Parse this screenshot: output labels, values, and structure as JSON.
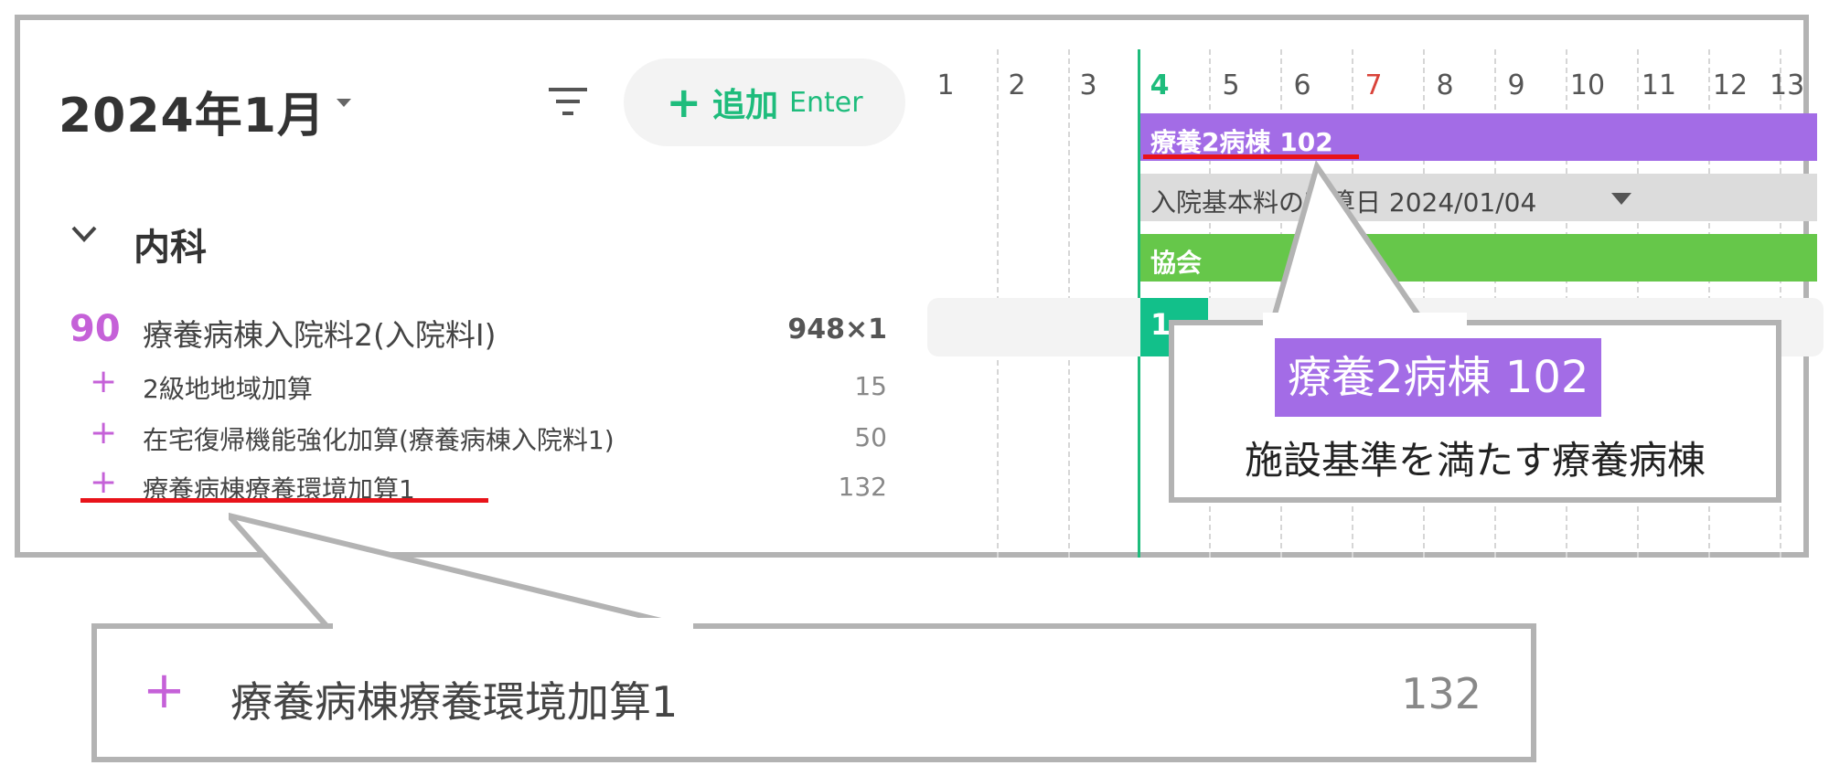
{
  "header": {
    "month": "2024年1月",
    "add_label": "追加",
    "add_hint": "Enter"
  },
  "department": {
    "label": "内科"
  },
  "main_item": {
    "code": "90",
    "name": "療養病棟入院料2(入院料I)",
    "qty": "948×1"
  },
  "add_items": [
    {
      "name": "2級地地域加算",
      "points": "15"
    },
    {
      "name": "在宅復帰機能強化加算(療養病棟入院料1)",
      "points": "50"
    },
    {
      "name": "療養病棟療養環境加算1",
      "points": "132"
    }
  ],
  "calendar": {
    "days": [
      "1",
      "2",
      "3",
      "4",
      "5",
      "6",
      "7",
      "8",
      "9",
      "10",
      "11",
      "12",
      "13"
    ],
    "today": "4",
    "holiday": "7",
    "today_color": "#1ebc7c",
    "holiday_color": "#d9433a"
  },
  "bars": {
    "ward": "療養2病棟 102",
    "basic": "入院基本料の起算日 2024/01/04",
    "association": "協会",
    "green_short": "1"
  },
  "callout_ward": {
    "tag": "療養2病棟 102",
    "description": "施設基準を満たす療養病棟"
  },
  "callout_item": {
    "name": "療養病棟療養環境加算1",
    "points": "132"
  },
  "colors": {
    "accent_green": "#1ebc7c",
    "accent_purple": "#c561d8",
    "ward_purple": "#a36ce6",
    "assoc_green": "#66c74a",
    "highlight_red": "#e8131a"
  }
}
